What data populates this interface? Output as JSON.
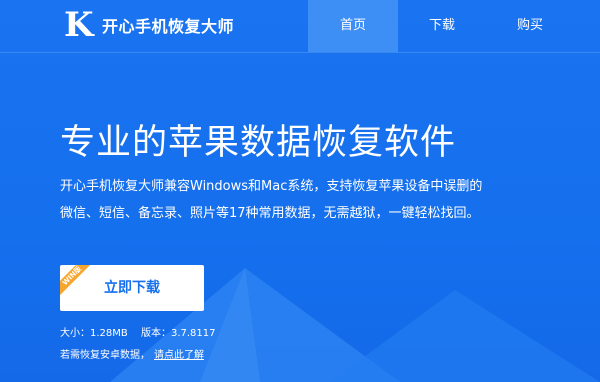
{
  "header": {
    "logo_letter": "K",
    "app_name": "开心手机恢复大师",
    "nav": [
      {
        "label": "首页",
        "active": true
      },
      {
        "label": "下载",
        "active": false
      },
      {
        "label": "购买",
        "active": false
      }
    ]
  },
  "hero": {
    "headline": "专业的苹果数据恢复软件",
    "description_lines": [
      "开心手机恢复大师兼容Windows和Mac系统，支持恢复苹果设备中误删的",
      "微信、短信、备忘录、照片等17种常用数据，无需越狱，一键轻松找回。"
    ],
    "download_button": {
      "label": "立即下载",
      "badge": "WIN版"
    },
    "size": "大小：1.28MB",
    "version": "版本：3.7.8117",
    "android_prompt": "若需恢复安卓数据，",
    "android_link": "请点此了解"
  },
  "colors": {
    "background": "#1677f0",
    "active_nav": "#3d8ff5",
    "button_text": "#1670ee",
    "badge": "#f7a62b"
  }
}
